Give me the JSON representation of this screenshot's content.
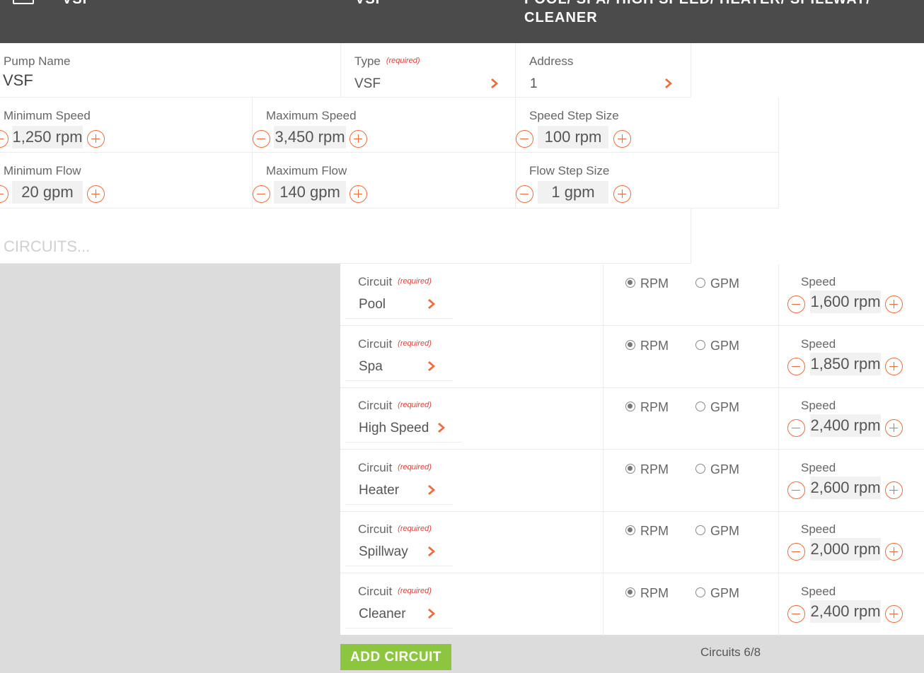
{
  "header": {
    "name": "VSF",
    "type": "VSF",
    "circuits_line1": "POOL/ SPA/ HIGH SPEED/ HEATER/ SPILLWAY/",
    "circuits_line2": "CLEANER"
  },
  "pump": {
    "name_label": "Pump Name",
    "name_value": "VSF",
    "type_label": "Type",
    "type_value": "VSF",
    "address_label": "Address",
    "address_value": "1",
    "required_text": "(required)"
  },
  "settings": {
    "min_speed": {
      "label": "Minimum Speed",
      "value": "1,250 rpm"
    },
    "max_speed": {
      "label": "Maximum Speed",
      "value": "3,450 rpm"
    },
    "speed_step": {
      "label": "Speed Step Size",
      "value": "100 rpm"
    },
    "min_flow": {
      "label": "Minimum Flow",
      "value": "20 gpm"
    },
    "max_flow": {
      "label": "Maximum Flow",
      "value": "140 gpm"
    },
    "flow_step": {
      "label": "Flow Step Size",
      "value": "1 gpm"
    }
  },
  "circuits_placeholder": "CIRCUITS...",
  "circuit_rows": [
    {
      "label": "Circuit",
      "required": "(required)",
      "name": "Pool",
      "rpm": "RPM",
      "gpm": "GPM",
      "speed_label": "Speed",
      "speed": "1,600 rpm",
      "unit": "RPM"
    },
    {
      "label": "Circuit",
      "required": "(required)",
      "name": "Spa",
      "rpm": "RPM",
      "gpm": "GPM",
      "speed_label": "Speed",
      "speed": "1,850 rpm",
      "unit": "RPM"
    },
    {
      "label": "Circuit",
      "required": "(required)",
      "name": "High Speed",
      "rpm": "RPM",
      "gpm": "GPM",
      "speed_label": "Speed",
      "speed": "2,400 rpm",
      "unit": "RPM"
    },
    {
      "label": "Circuit",
      "required": "(required)",
      "name": "Heater",
      "rpm": "RPM",
      "gpm": "GPM",
      "speed_label": "Speed",
      "speed": "2,600 rpm",
      "unit": "RPM"
    },
    {
      "label": "Circuit",
      "required": "(required)",
      "name": "Spillway",
      "rpm": "RPM",
      "gpm": "GPM",
      "speed_label": "Speed",
      "speed": "2,000 rpm",
      "unit": "RPM"
    },
    {
      "label": "Circuit",
      "required": "(required)",
      "name": "Cleaner",
      "rpm": "RPM",
      "gpm": "GPM",
      "speed_label": "Speed",
      "speed": "2,400 rpm",
      "unit": "RPM"
    }
  ],
  "add_circuit_label": "ADD CIRCUIT",
  "circuit_count": "Circuits 6/8",
  "colors": {
    "accent": "#ef6b3a",
    "header": "#4b4b4b",
    "add_button": "#8cc63f",
    "required": "#e0403a"
  }
}
